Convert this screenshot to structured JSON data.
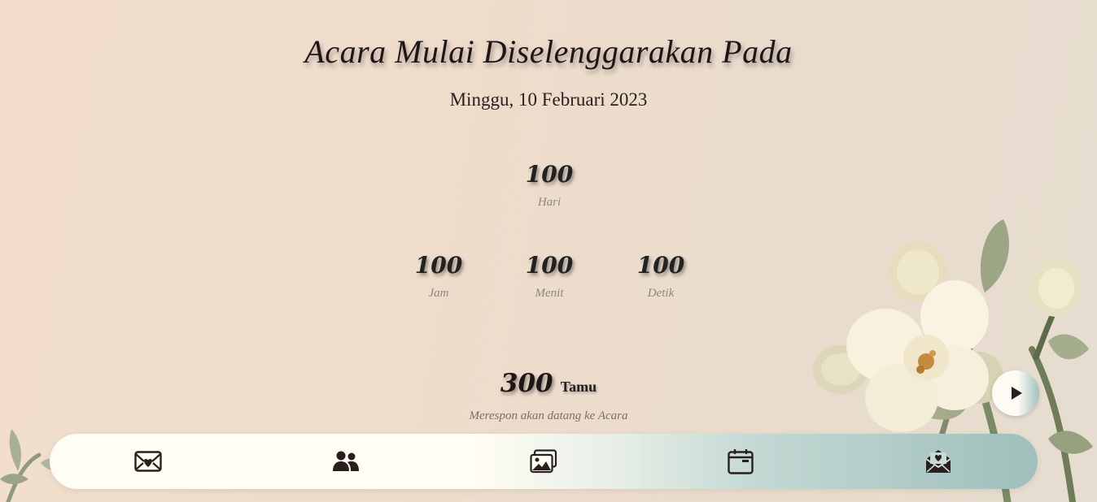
{
  "event": {
    "heading": "Acara Mulai Diselenggarakan Pada",
    "date": "Minggu, 10 Februari 2023"
  },
  "countdown": {
    "days": {
      "value": "100",
      "label": "Hari"
    },
    "hours": {
      "value": "100",
      "label": "Jam"
    },
    "minutes": {
      "value": "100",
      "label": "Menit"
    },
    "seconds": {
      "value": "100",
      "label": "Detik"
    }
  },
  "guests": {
    "count": "300",
    "unit": "Tamu",
    "description": "Merespon akan datang ke Acara"
  },
  "music": {
    "icon": "play-icon"
  },
  "nav": {
    "items": [
      {
        "icon": "envelope-heart-icon"
      },
      {
        "icon": "couple-icon"
      },
      {
        "icon": "gallery-icon"
      },
      {
        "icon": "calendar-icon"
      },
      {
        "icon": "envelope-letter-icon"
      }
    ]
  },
  "colors": {
    "background": "#efdccb",
    "nav_start": "#fffdf4",
    "nav_end": "#9ebfbb",
    "text": "#1e1616",
    "muted": "#888888"
  }
}
